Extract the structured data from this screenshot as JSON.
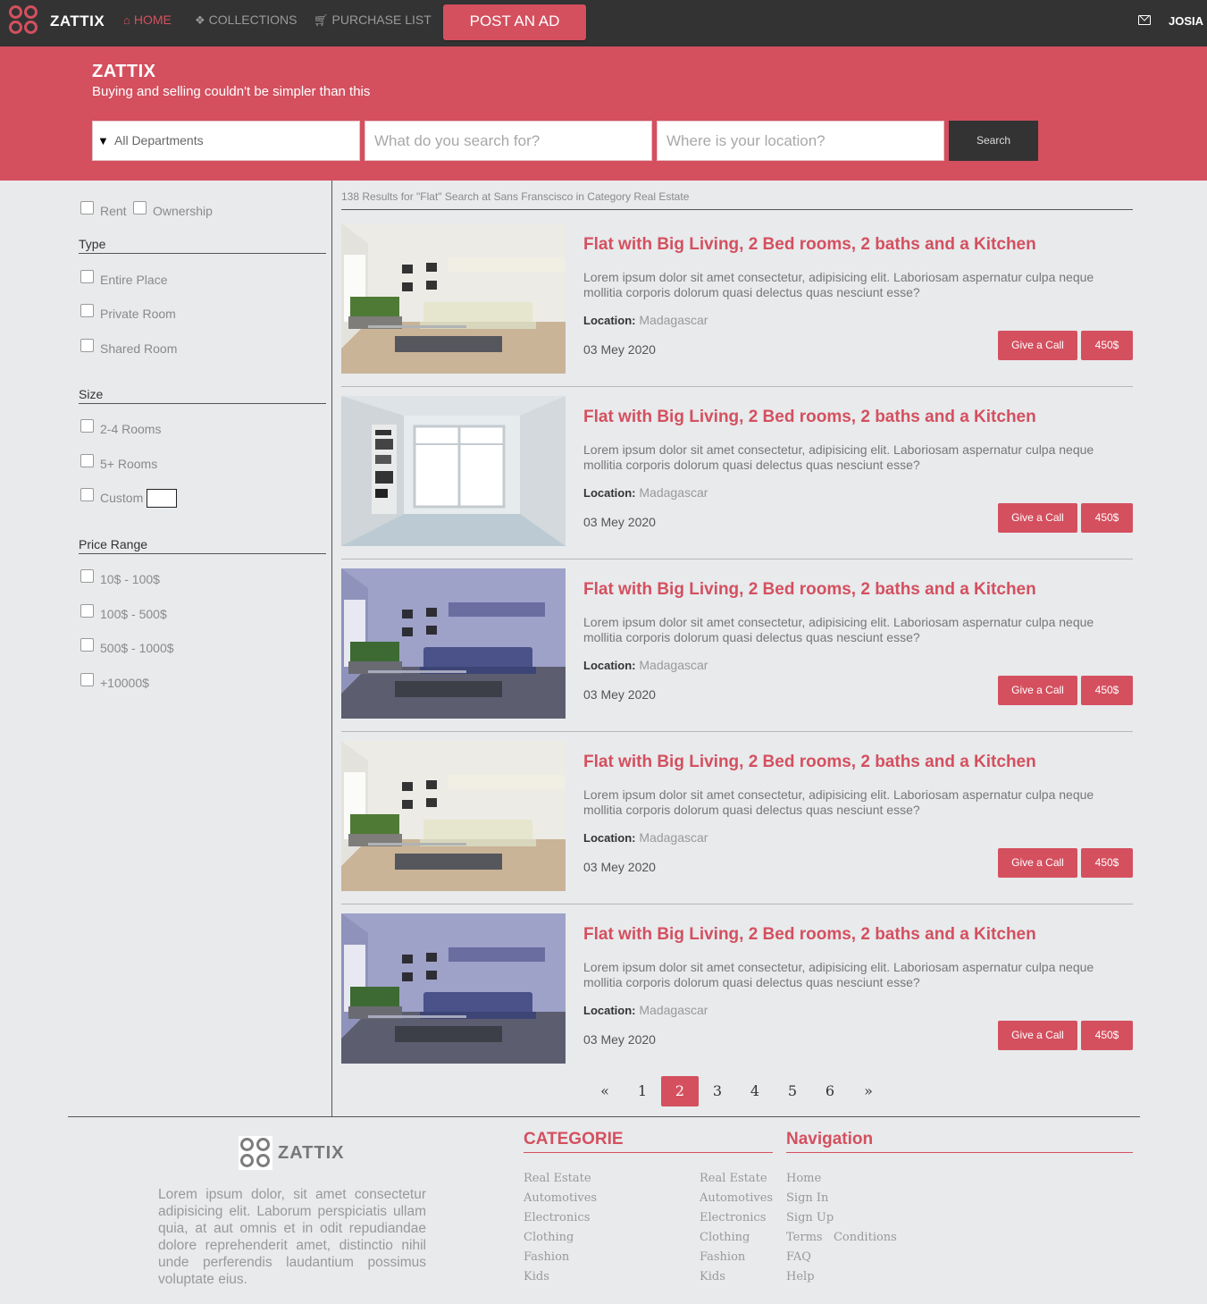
{
  "nav": {
    "brand": "ZATTIX",
    "home": "HOME",
    "collections": "COLLECTIONS",
    "purchase_list": "PURCHASE LIST",
    "post_ad": "POST AN AD",
    "user": "JOSIA",
    "icons": {
      "home": "home-icon",
      "collections": "cubes-icon",
      "purchase": "cart-icon",
      "mail": "mail-icon"
    }
  },
  "hero": {
    "title": "ZATTIX",
    "subtitle": "Buying and selling couldn't be simpler than this",
    "department": "All Departments",
    "search_placeholder": "What do you search for?",
    "location_placeholder": "Where is your location?",
    "search_button": "Search"
  },
  "filters": {
    "rent": "Rent",
    "ownership": "Ownership",
    "type_title": "Type",
    "types": [
      "Entire Place",
      "Private Room",
      "Shared Room"
    ],
    "size_title": "Size",
    "sizes": [
      "2-4 Rooms",
      "5+ Rooms",
      "Custom"
    ],
    "price_title": "Price Range",
    "prices": [
      "10$ - 100$",
      "100$ - 500$",
      "500$ - 1000$",
      "+10000$"
    ]
  },
  "results": {
    "summary": "138 Results for \"Flat\" Search at Sans Franscisco in Category Real Estate",
    "listings": [
      {
        "title": "Flat with Big Living, 2 Bed rooms, 2 baths and a Kitchen",
        "description": "Lorem ipsum dolor sit amet consectetur, adipisicing elit. Laboriosam aspernatur culpa neque mollitia corporis dolorum quasi delectus quas nesciunt esse?",
        "location_label": "Location:",
        "location": "Madagascar",
        "date": "03 Mey 2020",
        "call": "Give a Call",
        "price": "450$"
      },
      {
        "title": "Flat with Big Living, 2 Bed rooms, 2 baths and a Kitchen",
        "description": "Lorem ipsum dolor sit amet consectetur, adipisicing elit. Laboriosam aspernatur culpa neque mollitia corporis dolorum quasi delectus quas nesciunt esse?",
        "location_label": "Location:",
        "location": "Madagascar",
        "date": "03 Mey 2020",
        "call": "Give a Call",
        "price": "450$"
      },
      {
        "title": "Flat with Big Living, 2 Bed rooms, 2 baths and a Kitchen",
        "description": "Lorem ipsum dolor sit amet consectetur, adipisicing elit. Laboriosam aspernatur culpa neque mollitia corporis dolorum quasi delectus quas nesciunt esse?",
        "location_label": "Location:",
        "location": "Madagascar",
        "date": "03 Mey 2020",
        "call": "Give a Call",
        "price": "450$"
      },
      {
        "title": "Flat with Big Living, 2 Bed rooms, 2 baths and a Kitchen",
        "description": "Lorem ipsum dolor sit amet consectetur, adipisicing elit. Laboriosam aspernatur culpa neque mollitia corporis dolorum quasi delectus quas nesciunt esse?",
        "location_label": "Location:",
        "location": "Madagascar",
        "date": "03 Mey 2020",
        "call": "Give a Call",
        "price": "450$"
      },
      {
        "title": "Flat with Big Living, 2 Bed rooms, 2 baths and a Kitchen",
        "description": "Lorem ipsum dolor sit amet consectetur, adipisicing elit. Laboriosam aspernatur culpa neque mollitia corporis dolorum quasi delectus quas nesciunt esse?",
        "location_label": "Location:",
        "location": "Madagascar",
        "date": "03 Mey 2020",
        "call": "Give a Call",
        "price": "450$"
      }
    ]
  },
  "pagination": {
    "prev": "«",
    "pages": [
      "1",
      "2",
      "3",
      "4",
      "5",
      "6"
    ],
    "active": "2",
    "next": "»"
  },
  "footer": {
    "brand": "ZATTIX",
    "about": "Lorem ipsum dolor, sit amet consectetur adipisicing elit. Laborum perspiciatis ullam quia, at aut omnis et in odit repudiandae dolore reprehenderit amet, distinctio nihil unde perferendis laudantium possimus voluptate eius.",
    "category_title": "CATEGORIE",
    "categories_col1": [
      "Real Estate",
      "Automotives",
      "Electronics",
      "Clothing",
      "Fashion",
      "Kids"
    ],
    "categories_col2": [
      "Real Estate",
      "Automotives",
      "Electronics",
      "Clothing",
      "Fashion",
      "Kids"
    ],
    "navigation_title": "Navigation",
    "navigation": [
      "Home",
      "Sign In",
      "Sign Up",
      "Terms   Conditions",
      "FAQ",
      "Help"
    ]
  },
  "colors": {
    "accent": "#d4505f",
    "navbar": "#333333",
    "background": "#e8eaec"
  }
}
